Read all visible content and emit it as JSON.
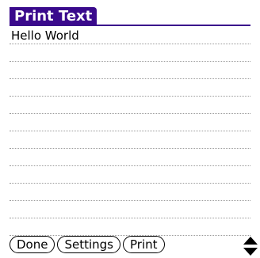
{
  "app": {
    "title": "Print Text"
  },
  "editor": {
    "lines": [
      "Hello World",
      "",
      "",
      "",
      "",
      "",
      "",
      "",
      "",
      "",
      "",
      ""
    ]
  },
  "buttons": [
    {
      "label": "Done"
    },
    {
      "label": "Settings"
    },
    {
      "label": "Print"
    }
  ],
  "colors": {
    "title_bar": "#3a0a8c",
    "rule": "#9a9a9a"
  },
  "scroll": {
    "icon": "scroll-arrows-icon"
  }
}
